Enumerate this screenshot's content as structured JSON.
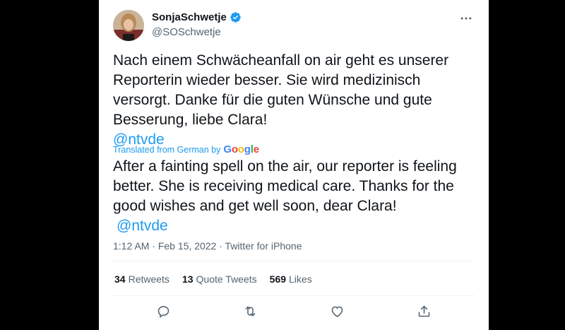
{
  "tweet": {
    "display_name": "SonjaSchwetje",
    "handle": "@SOSchwetje",
    "text": "Nach einem Schwächeanfall on air geht es unserer Reporterin wieder besser. Sie wird medizinisch versorgt. Danke für die guten Wünsche und gute Besserung, liebe Clara!",
    "mention": "@ntvde",
    "translated_label": "Translated from German by",
    "translation_provider": "Google",
    "translation": "After a fainting spell on the air, our reporter is feeling better. She is receiving medical care. Thanks for the good wishes and get well soon, dear Clara!",
    "translation_mention": "@ntvde",
    "time": "1:12 AM",
    "date": "Feb 15, 2022",
    "source": "Twitter for iPhone",
    "separator": "·"
  },
  "stats": {
    "retweets_count": "34",
    "retweets_label": "Retweets",
    "quotes_count": "13",
    "quotes_label": "Quote Tweets",
    "likes_count": "569",
    "likes_label": "Likes"
  },
  "colors": {
    "accent": "#1d9bf0",
    "text": "#0f1419",
    "secondary": "#536471",
    "background": "#000000"
  },
  "icons": {
    "verified": "verified-badge-icon",
    "more": "more-options-icon",
    "reply": "reply-icon",
    "retweet": "retweet-icon",
    "like": "like-icon",
    "share": "share-icon"
  }
}
